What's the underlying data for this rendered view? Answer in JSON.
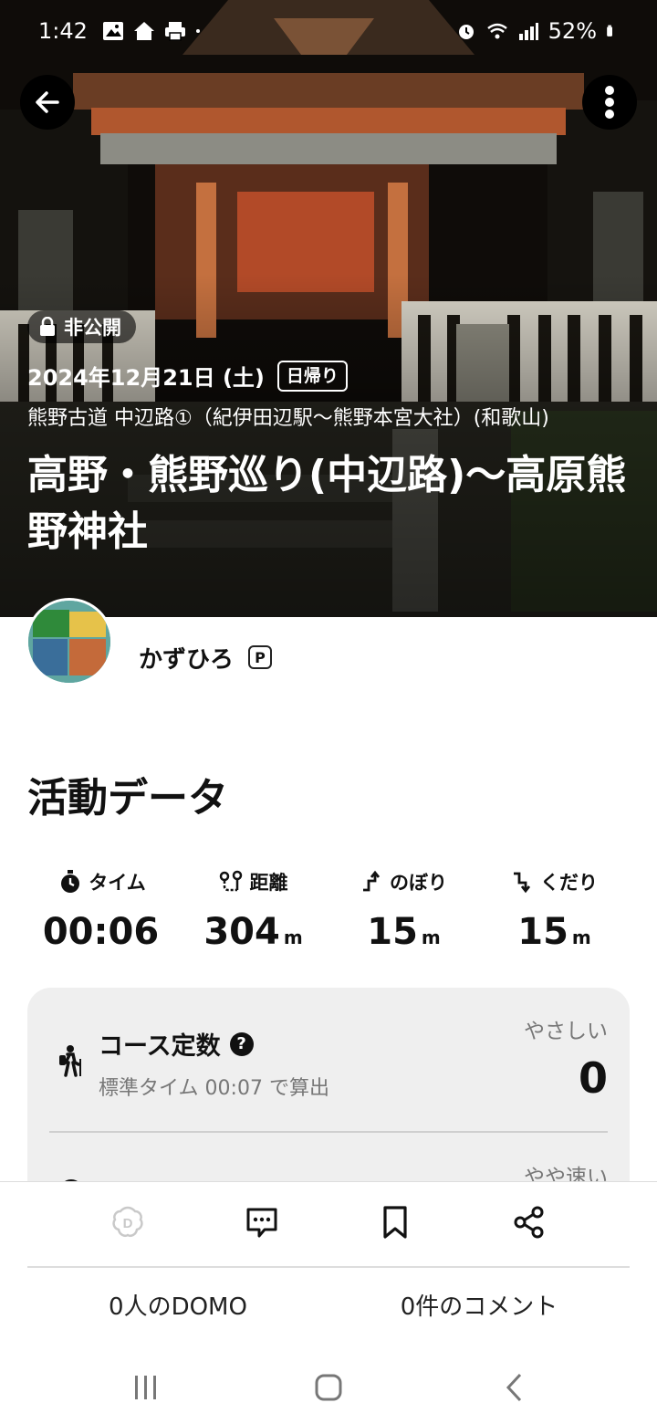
{
  "status_bar": {
    "time": "1:42",
    "battery_percent": "52%"
  },
  "hero": {
    "visibility_badge": "非公開",
    "date": "2024年12月21日 (土)",
    "trip_type": "日帰り",
    "route_name": "熊野古道 中辺路①（紀伊田辺駅〜熊野本宮大社）(和歌山)",
    "title": "高野・熊野巡り(中辺路)〜高原熊野神社"
  },
  "author": {
    "name": "かずひろ",
    "premium_badge": "P"
  },
  "activity": {
    "section_title": "活動データ",
    "stats": [
      {
        "label": "タイム",
        "value": "00:06",
        "unit": "",
        "icon": "stopwatch-icon"
      },
      {
        "label": "距離",
        "value": "304",
        "unit": "m",
        "icon": "route-distance-icon"
      },
      {
        "label": "のぼり",
        "value": "15",
        "unit": "m",
        "icon": "ascent-icon"
      },
      {
        "label": "くだり",
        "value": "15",
        "unit": "m",
        "icon": "descent-icon"
      }
    ],
    "course": {
      "title": "コース定数",
      "subtitle": "標準タイム 00:07 で算出",
      "level": "やさしい",
      "value": "0",
      "next_level": "やや速い"
    }
  },
  "actions": {
    "domo_count": "0人のDOMO",
    "comment_count": "0件のコメント"
  },
  "colors": {
    "accent_text": "#111111",
    "muted_text": "#777777",
    "card_bg": "#efefef"
  }
}
